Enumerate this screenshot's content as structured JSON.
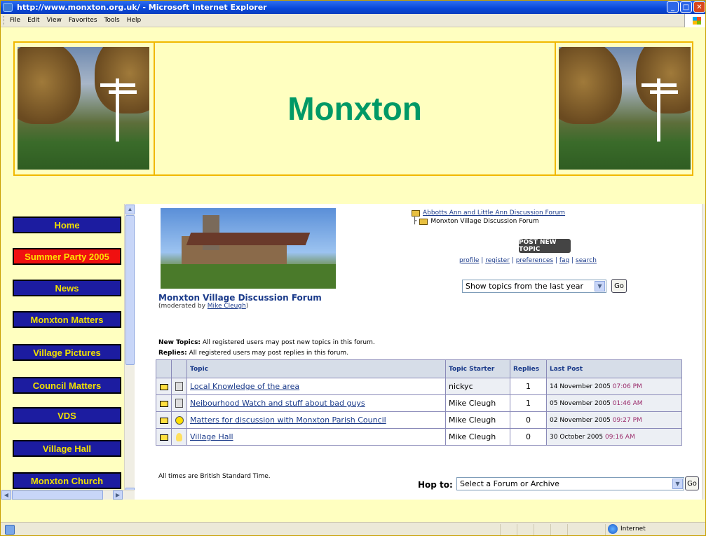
{
  "window": {
    "title": "http://www.monxton.org.uk/ - Microsoft Internet Explorer"
  },
  "menubar": {
    "items": [
      "File",
      "Edit",
      "View",
      "Favorites",
      "Tools",
      "Help"
    ]
  },
  "banner": {
    "title": "Monxton"
  },
  "sidebar": {
    "items": [
      {
        "label": "Home"
      },
      {
        "label": "Summer Party 2005"
      },
      {
        "label": "News"
      },
      {
        "label": "Monxton Matters"
      },
      {
        "label": "Village Pictures"
      },
      {
        "label": "Council Matters"
      },
      {
        "label": "VDS"
      },
      {
        "label": "Village Hall"
      },
      {
        "label": "Monxton Church"
      }
    ]
  },
  "forum": {
    "breadcrumb_parent": "Abbotts Ann and Little Ann Discussion Forum",
    "breadcrumb_current": "Monxton Village Discussion Forum",
    "new_topic_label": "POST NEW TOPIC",
    "links": {
      "profile": "profile",
      "register": "register",
      "preferences": "preferences",
      "faq": "faq",
      "search": "search"
    },
    "topic_filter": "Show topics from the last year",
    "go_label": "Go",
    "title": "Monxton Village Discussion Forum",
    "moderated_prefix": "(moderated by ",
    "moderator": "Mike Cleugh",
    "moderated_suffix": ")",
    "permissions": {
      "new_topics_label": "New Topics:",
      "new_topics_text": " All registered users may post new topics in this forum.",
      "replies_label": "Replies:",
      "replies_text": " All registered users may post replies in this forum."
    },
    "table": {
      "headers": {
        "topic": "Topic",
        "starter": "Topic Starter",
        "replies": "Replies",
        "last_post": "Last Post"
      },
      "rows": [
        {
          "icon": "text-icon",
          "topic": "Local Knowledge of the area",
          "starter": "nickyc",
          "replies": "1",
          "last_date": "14 November 2005",
          "last_time": "07:06 PM"
        },
        {
          "icon": "text-icon",
          "topic": "Neibourhood Watch and stuff about bad guys",
          "starter": "Mike Cleugh",
          "replies": "1",
          "last_date": "05 November 2005",
          "last_time": "01:46 AM"
        },
        {
          "icon": "smiley-icon",
          "topic": "Matters for discussion with Monxton Parish Council",
          "starter": "Mike Cleugh",
          "replies": "0",
          "last_date": "02 November 2005",
          "last_time": "09:27 PM"
        },
        {
          "icon": "lightbulb-icon",
          "topic": "Village Hall",
          "starter": "Mike Cleugh",
          "replies": "0",
          "last_date": "30 October 2005",
          "last_time": "09:16 AM"
        }
      ]
    },
    "footnote": "All times are British Standard Time.",
    "hop_to_label": "Hop to:",
    "hop_to_value": "Select a Forum or Archive"
  },
  "status": {
    "zone": "Internet"
  },
  "colors": {
    "page_bg": "#ffffc0",
    "title_green": "#009966",
    "nav_blue": "#1c1ca0",
    "nav_red": "#f01010",
    "nav_text": "#f0e000",
    "banner_border": "#f0b800"
  }
}
